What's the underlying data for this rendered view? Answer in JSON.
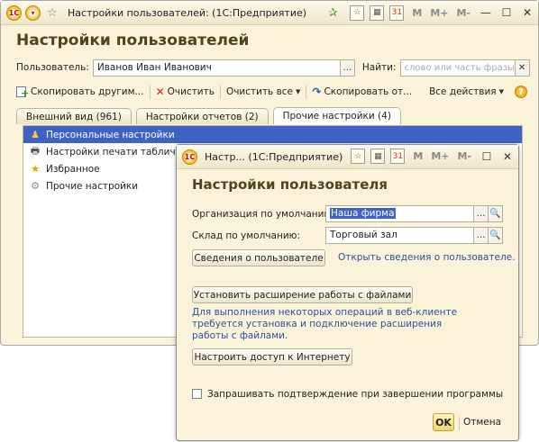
{
  "main": {
    "title": "Настройки пользователей:  (1С:Предприятие)",
    "heading": "Настройки пользователей",
    "user_label": "Пользователь:",
    "user_value": "Иванов Иван Иванович",
    "find_label": "Найти:",
    "find_placeholder": "слово или часть фразы",
    "toolbar": {
      "copy_to_others": "Скопировать другим...",
      "clear": "Очистить",
      "clear_all": "Очистить все",
      "copy_from": "Скопировать от...",
      "all_actions": "Все действия"
    },
    "tabs": [
      {
        "label": "Внешний вид (961)"
      },
      {
        "label": "Настройки отчетов (2)"
      },
      {
        "label": "Прочие настройки (4)"
      }
    ],
    "items": [
      {
        "label": "Персональные настройки"
      },
      {
        "label": "Настройки печати табличны"
      },
      {
        "label": "Избранное"
      },
      {
        "label": "Прочие настройки"
      }
    ]
  },
  "dialog": {
    "title": "Настр...  (1С:Предприятие)",
    "heading": "Настройки пользователя",
    "org_label": "Организация по умолчанию:",
    "org_value": "Наша фирма",
    "warehouse_label": "Склад по умолчанию:",
    "warehouse_value": "Торговый зал",
    "user_info_button": "Сведения о пользователе",
    "user_info_link": "Открыть сведения о пользователе.",
    "install_ext_button": "Установить расширение работы с файлами",
    "info_text": "Для выполнения некоторых операций в веб-клиенте требуется установка и подключение расширения работы с файлами.",
    "internet_button": "Настроить доступ к Интернету",
    "confirm_exit_label": "Запрашивать подтверждение при завершении программы",
    "ok": "OK",
    "cancel": "Отмена"
  },
  "window_buttons": {
    "m": "M",
    "m_plus": "M+",
    "m_minus": "M-"
  },
  "colors": {
    "window_bg": "#fbf3d9",
    "heading": "#4f4320",
    "selection": "#3e63c5",
    "link": "#2b4f9c"
  }
}
